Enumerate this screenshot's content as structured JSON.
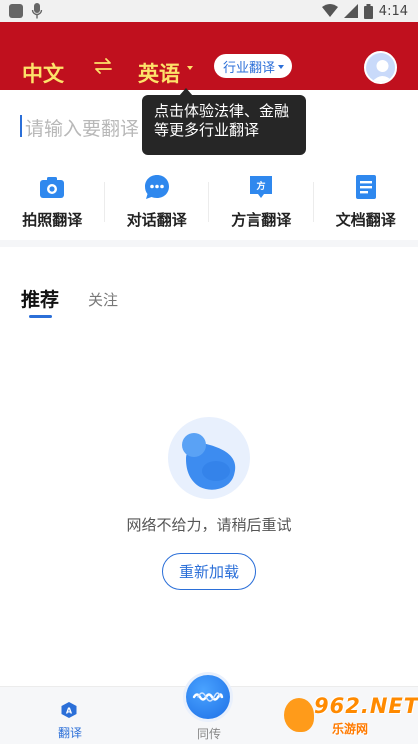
{
  "status_bar": {
    "time": "4:14"
  },
  "header": {
    "source_lang": "中文",
    "target_lang": "英语",
    "industry_button": "行业翻译",
    "accent_color": "#c0101e",
    "lang_color": "#fde26a"
  },
  "input": {
    "placeholder": "请输入要翻译"
  },
  "tooltip": {
    "text": "点击体验法律、金融等更多行业翻译"
  },
  "tools": [
    {
      "label": "拍照翻译",
      "icon": "camera-icon"
    },
    {
      "label": "对话翻译",
      "icon": "chat-bubble-icon"
    },
    {
      "label": "方言翻译",
      "icon": "dialect-icon"
    },
    {
      "label": "文档翻译",
      "icon": "document-icon"
    }
  ],
  "tabs": {
    "recommend": "推荐",
    "follow": "关注"
  },
  "empty_state": {
    "message": "网络不给力，请稍后重试",
    "reload_button": "重新加载"
  },
  "bottom_nav": {
    "translate": "翻译",
    "simultaneous": "同传",
    "active_color": "#2b6fd8"
  },
  "watermark": {
    "brand": "962.NET",
    "sub": "乐游网"
  }
}
